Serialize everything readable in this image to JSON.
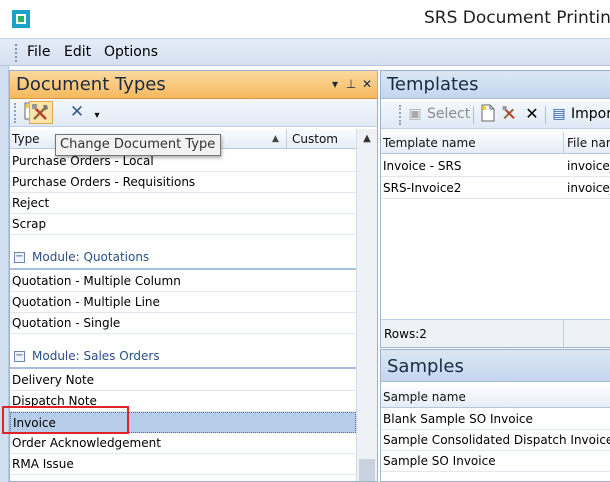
{
  "app": {
    "title": "SRS Document Printin"
  },
  "menu": [
    "File",
    "Edit",
    "Options"
  ],
  "doc_panel": {
    "title": "Document Types",
    "pin_glyph": "▾ ⊥",
    "columns": [
      "Type",
      "Custom"
    ],
    "tooltip": "Change Document Type",
    "rows_top": [
      "Purchase Orders - Local",
      "Purchase Orders - Requisitions",
      "Reject",
      "Scrap"
    ],
    "groups": [
      {
        "label": "Module: Quotations",
        "toggle": "−",
        "rows": [
          "Quotation - Multiple Column",
          "Quotation - Multiple Line",
          "Quotation - Single"
        ]
      },
      {
        "label": "Module: Sales Orders",
        "toggle": "−",
        "rows": [
          "Delivery Note",
          "Dispatch Note",
          "Invoice",
          "Order Acknowledgement",
          "RMA Issue"
        ]
      }
    ],
    "selected_row": "Invoice"
  },
  "templates_panel": {
    "title": "Templates",
    "toolbar": {
      "select": "Select",
      "import": "Impor"
    },
    "columns": [
      "Template name",
      "File nar"
    ],
    "rows": [
      {
        "name": "Invoice - SRS",
        "file": "invoice_"
      },
      {
        "name": "SRS-Invoice2",
        "file": "invoice_"
      }
    ],
    "footer": "Rows:2"
  },
  "samples_panel": {
    "title": "Samples",
    "column": "Sample name",
    "rows": [
      "Blank Sample SO Invoice",
      "Sample Consolidated Dispatch Invoice",
      "Sample SO Invoice"
    ]
  },
  "colors": {
    "accent_orange": "#f6b95d",
    "highlight_red": "#e0242a",
    "selected_row": "#b7cdea"
  }
}
